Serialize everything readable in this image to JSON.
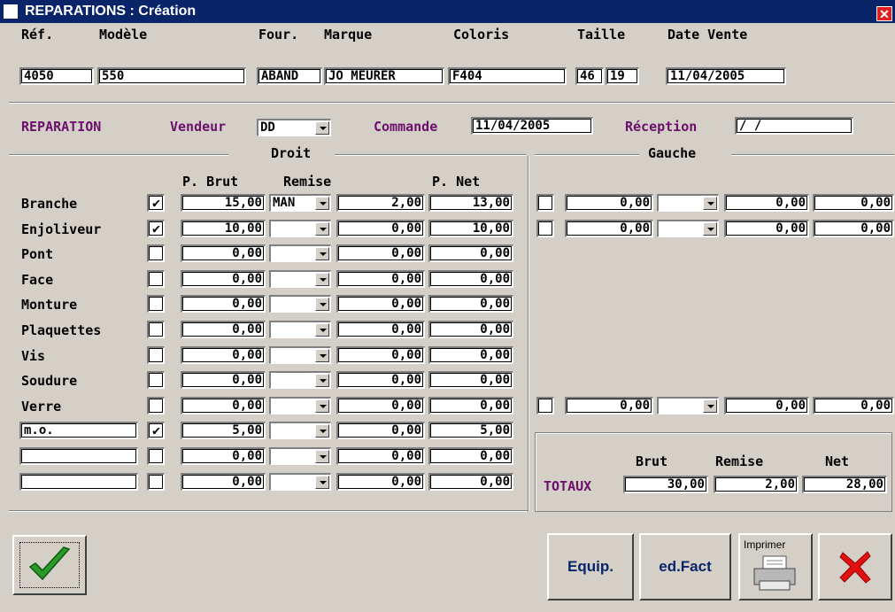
{
  "window": {
    "title": "REPARATIONS : Création"
  },
  "header": {
    "labels": {
      "ref": "Réf.",
      "modele": "Modèle",
      "four": "Four.",
      "marque": "Marque",
      "coloris": "Coloris",
      "taille": "Taille",
      "date_vente": "Date Vente"
    },
    "values": {
      "ref": "4050",
      "modele": "550",
      "four": "ABAND",
      "marque": "JO MEURER",
      "coloris": "F404",
      "taille1": "46",
      "taille2": "19",
      "date_vente": "11/04/2005"
    }
  },
  "reparation": {
    "title": "REPARATION",
    "vendeur_label": "Vendeur",
    "vendeur_value": "DD",
    "commande_label": "Commande",
    "commande_value": "11/04/2005",
    "reception_label": "Réception",
    "reception_value": " /  /"
  },
  "sections": {
    "droit": "Droit",
    "gauche": "Gauche"
  },
  "columns": {
    "brut": "P. Brut",
    "remise": "Remise",
    "net": "P. Net"
  },
  "rows": [
    {
      "label": "Branche",
      "checked": "✔",
      "brut": "15,00",
      "remise_type": "MAN",
      "remise": "2,00",
      "net": "13,00"
    },
    {
      "label": "Enjoliveur",
      "checked": "✔",
      "brut": "10,00",
      "remise_type": "",
      "remise": "0,00",
      "net": "10,00"
    },
    {
      "label": "Pont",
      "checked": "",
      "brut": "0,00",
      "remise_type": "",
      "remise": "0,00",
      "net": "0,00"
    },
    {
      "label": "Face",
      "checked": "",
      "brut": "0,00",
      "remise_type": "",
      "remise": "0,00",
      "net": "0,00"
    },
    {
      "label": "Monture",
      "checked": "",
      "brut": "0,00",
      "remise_type": "",
      "remise": "0,00",
      "net": "0,00"
    },
    {
      "label": "Plaquettes",
      "checked": "",
      "brut": "0,00",
      "remise_type": "",
      "remise": "0,00",
      "net": "0,00"
    },
    {
      "label": "Vis",
      "checked": "",
      "brut": "0,00",
      "remise_type": "",
      "remise": "0,00",
      "net": "0,00"
    },
    {
      "label": "Soudure",
      "checked": "",
      "brut": "0,00",
      "remise_type": "",
      "remise": "0,00",
      "net": "0,00"
    },
    {
      "label": "Verre",
      "checked": "",
      "brut": "0,00",
      "remise_type": "",
      "remise": "0,00",
      "net": "0,00"
    },
    {
      "label": "m.o.",
      "checked": "✔",
      "brut": "5,00",
      "remise_type": "",
      "remise": "0,00",
      "net": "5,00"
    },
    {
      "label": "",
      "checked": "",
      "brut": "0,00",
      "remise_type": "",
      "remise": "0,00",
      "net": "0,00"
    },
    {
      "label": "",
      "checked": "",
      "brut": "0,00",
      "remise_type": "",
      "remise": "0,00",
      "net": "0,00"
    }
  ],
  "gauche_rows": [
    {
      "brut": "0,00",
      "remise": "0,00",
      "net": "0,00"
    },
    {
      "brut": "0,00",
      "remise": "0,00",
      "net": "0,00"
    },
    {
      "brut": "0,00",
      "remise": "0,00",
      "net": "0,00"
    }
  ],
  "totaux": {
    "label": "TOTAUX",
    "brut_label": "Brut",
    "remise_label": "Remise",
    "net_label": "Net",
    "brut": "30,00",
    "remise": "2,00",
    "net": "28,00"
  },
  "buttons": {
    "equip": "Equip.",
    "edfact": "ed.Fact",
    "imprimer": "Imprimer"
  },
  "colors": {
    "titlebar": "#0a246a",
    "accent_purple": "#6b0f6b",
    "ok_green": "#2a9a2a",
    "cancel_red": "#e01010"
  }
}
